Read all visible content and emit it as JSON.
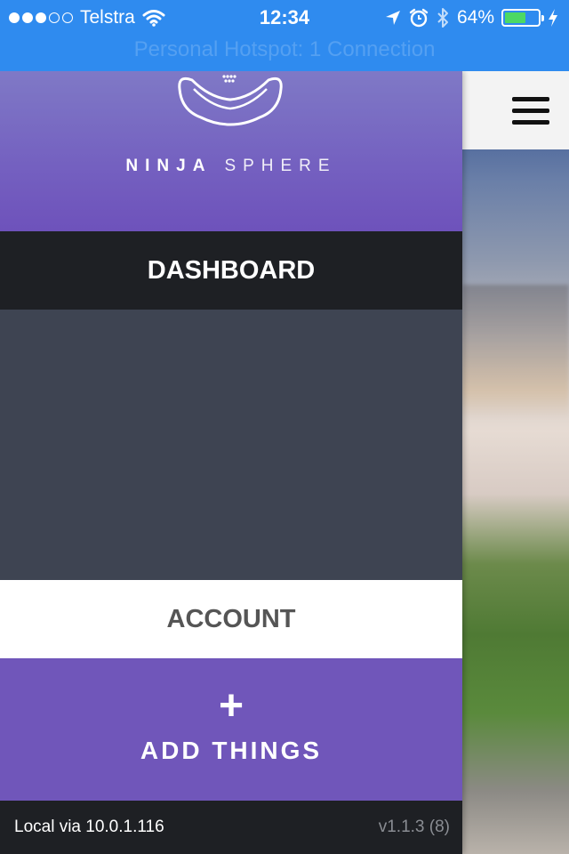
{
  "status_bar": {
    "carrier": "Telstra",
    "time": "12:34",
    "battery_percent": "64%",
    "battery_level": 0.64,
    "signal_dots_filled": 3,
    "signal_dots_total": 5,
    "hotspot": "Personal Hotspot: 1 Connection",
    "icons": [
      "wifi-icon",
      "location-arrow-icon",
      "alarm-icon",
      "bluetooth-icon",
      "battery-icon",
      "charging-bolt-icon"
    ]
  },
  "drawer": {
    "brand_part1": "NINJA",
    "brand_part2": "SPHERE",
    "nav": {
      "dashboard": "DASHBOARD",
      "account": "ACCOUNT"
    },
    "add": {
      "icon": "+",
      "label": "ADD THINGS"
    },
    "footer": {
      "connection": "Local via 10.0.1.116",
      "version": "v1.1.3 (8)"
    }
  },
  "colors": {
    "status_bar": "#2f8bef",
    "brand_purple": "#7056ba",
    "dark": "#1e2024",
    "slate": "#3e4452"
  }
}
